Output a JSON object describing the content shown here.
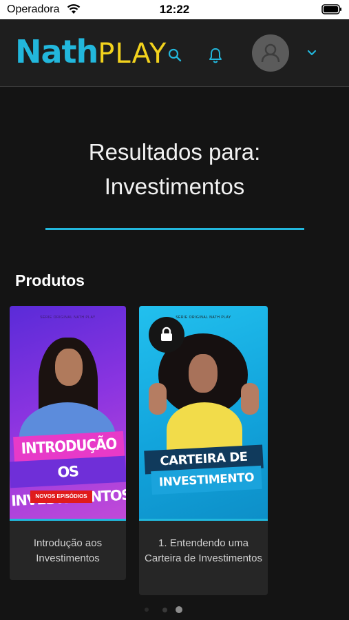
{
  "status_bar": {
    "carrier": "Operadora",
    "time": "12:22"
  },
  "header": {
    "logo_nath": "Nath",
    "logo_play": "PLAY",
    "icons": [
      "search-icon",
      "bell-icon",
      "avatar",
      "chevron-down-icon"
    ]
  },
  "results": {
    "line1": "Resultados para:",
    "line2": "Investimentos"
  },
  "section": {
    "title": "Produtos"
  },
  "products": [
    {
      "serie_label": "SÉRIE ORIGINAL NATH PLAY",
      "banner_line1": "INTRODUÇÃO",
      "banner_line2": "OS INVESTIMENTOS",
      "badge": "NOVOS EPISÓDIOS",
      "caption": "Introdução aos Investimentos",
      "locked": false
    },
    {
      "serie_label": "SÉRIE ORIGINAL NATH PLAY",
      "banner_line1": "CARTEIRA DE",
      "banner_line2": "INVESTIMENTO",
      "caption": "1. Entendendo uma Carteira de Investimentos",
      "locked": true
    }
  ],
  "pagination": {
    "pages": 3,
    "current": 3
  },
  "colors": {
    "accent": "#22b7dc",
    "logo_yellow": "#f2d21d",
    "background": "#141414"
  }
}
